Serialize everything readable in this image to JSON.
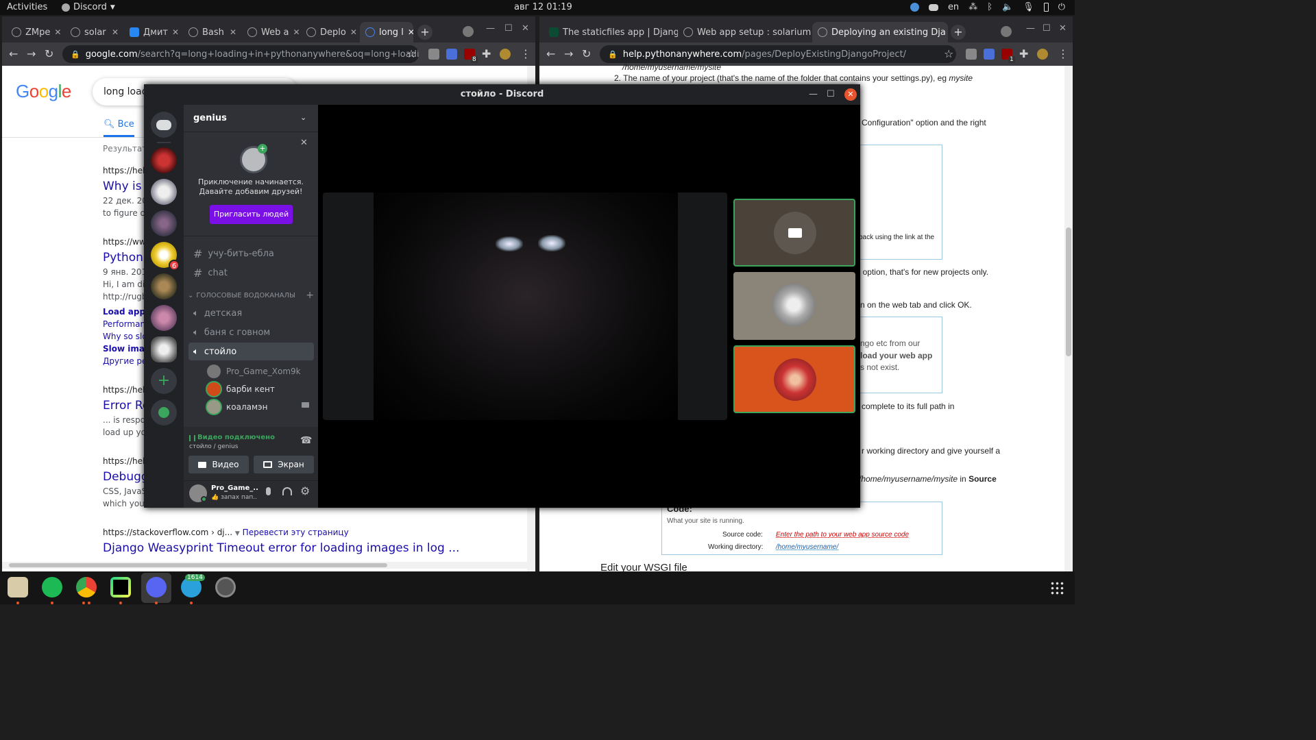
{
  "topbar": {
    "activities": "Activities",
    "app_name": "Discord",
    "clock": "авг 12  01:19",
    "lang": "en"
  },
  "left_browser": {
    "tabs": [
      "ZMpe",
      "solar",
      "Дмит",
      "Bash",
      "Web a",
      "Deplo",
      "long l"
    ],
    "url_host": "google.com",
    "url_path": "/search?q=long+loading+in+pythonanywhere&oq=long+loading+in+python...",
    "extension_badge": "8",
    "search_query": "long loadi",
    "nav_all": "Все",
    "results_prefix": "Результато",
    "results": [
      {
        "cite": "https://help.",
        "title": "Why is n",
        "date": "22 дек. 201",
        "snip": "to figure out"
      },
      {
        "cite": "https://www",
        "title": "Pythona",
        "date": "9 янв. 2018",
        "snip": "Hi, I am disa",
        "snip2": "http://rugbu"
      },
      {
        "cite": "https://help.",
        "title": "Error Re",
        "snip": "... is respon",
        "snip2": "load up you"
      },
      {
        "cite": "https://help.",
        "title": "Debuggi",
        "snip": "CSS, JavaS",
        "snip2": "which you e"
      }
    ],
    "sublinks": [
      "Load apps",
      "Performanc",
      "Why so slo",
      "Slow image",
      "Другие резу"
    ],
    "bottom_cite": "https://stackoverflow.com › dj...",
    "bottom_translate": "Перевести эту страницу",
    "bottom_title": "Django Weasyprint Timeout error for loading images in log ..."
  },
  "right_browser": {
    "tabs": [
      "The staticfiles app | Djang",
      "Web app setup : solarium",
      "Deploying an existing Dja"
    ],
    "url_host": "help.pythonanywhere.com",
    "url_path": "/pages/DeployExistingDjangoProject/",
    "extension_badge": "1",
    "doc": {
      "path1": "/home/myusername/mysite",
      "item2_prefix": "2. The name of your project (that's the name of the folder that contains your settings.py), eg",
      "item2_em": "mysite",
      "config": "Configuration\" option and the right",
      "back": "back using the link at the",
      "option": "' option, that's for new projects only.",
      "web_tab": "n on the web tab and click OK.",
      "go_etc": "ngo etc from our",
      "load_web": "load your web app",
      "not_exist": "s not exist.",
      "complete": "complete to its full path in",
      "working": "r working directory and give yourself a",
      "mysite_in": "/home/myusername/mysite",
      "in_word": "in",
      "source_word": "Source",
      "code_head": "Code:",
      "running": "What your site is running.",
      "src_label": "Source code:",
      "src_val": "Enter the path to your web app source code",
      "wd_label": "Working directory:",
      "wd_val": "/home/myusername/",
      "edit_wsgi": "Edit your WSGI file"
    }
  },
  "discord": {
    "title": "стойло - Discord",
    "server": "genius",
    "invite_text1": "Приключение начинается.",
    "invite_text2": "Давайте добавим друзей!",
    "invite_button": "Пригласить людей",
    "text_channels": [
      "учу-бить-ебла",
      "chat"
    ],
    "voice_category": "ГОЛОСОВЫЕ ВОДОКАНАЛЫ",
    "voice_channels": [
      "детская",
      "баня с говном",
      "стойло"
    ],
    "voice_users": [
      "Pro_Game_Xom9k",
      "барби кент",
      "коаламэн"
    ],
    "guild_badge": "6",
    "status_title": "Видео подключено",
    "status_sub": "стойло / genius",
    "video_button": "Видео",
    "screen_button": "Экран",
    "user_name": "Pro_Game_...",
    "user_status": "👍 запах пап...",
    "accent": "#5865f2",
    "invite_color": "#7a0fe6",
    "green": "#3ba55d"
  },
  "dock": {
    "telegram_badge": "1614"
  }
}
